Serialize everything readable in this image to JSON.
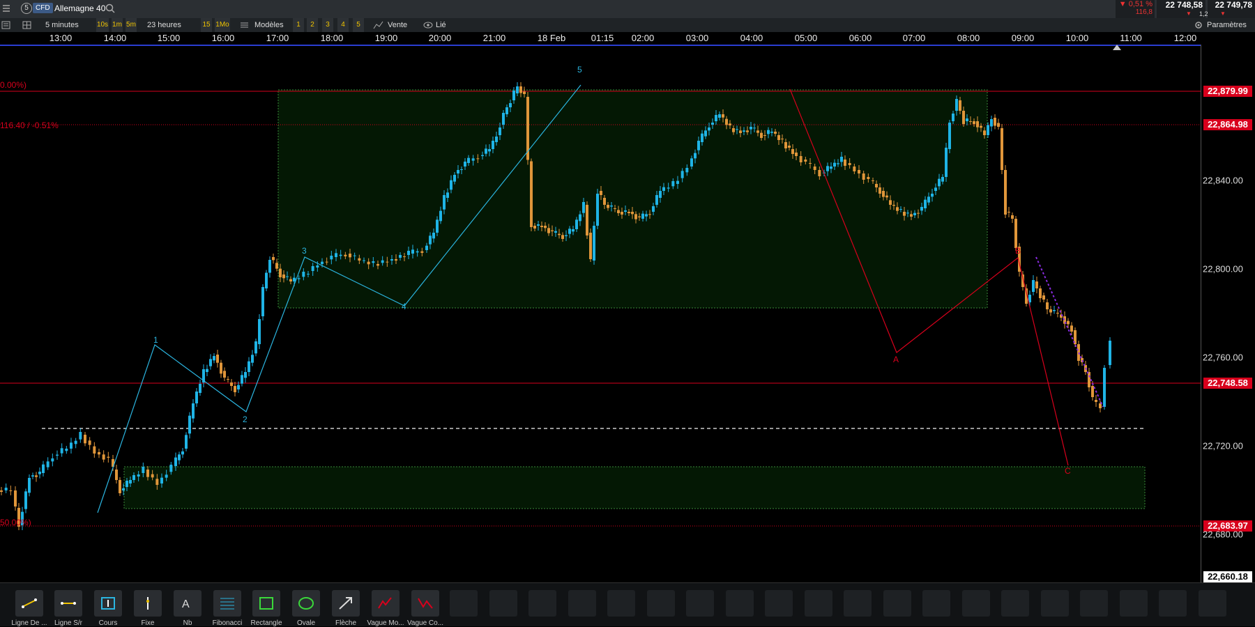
{
  "top": {
    "badge_num": "5",
    "badge_type": "CFD",
    "instrument": "Allemagne 40",
    "change_pct": "▼ 0,51 %",
    "change_pts": "116,8",
    "bid": "22 748,58",
    "spread": "1,20",
    "ask": "22 749,78"
  },
  "toolbar": {
    "timeframe": "5 minutes",
    "tf_10s": "10s",
    "tf_1m": "1m",
    "tf_5m": "5m",
    "duration": "23 heures",
    "d_15": "15",
    "d_1mo": "1Mo",
    "models": "Modèles",
    "m1": "1",
    "m2": "2",
    "m3": "3",
    "m4": "4",
    "m5": "5",
    "sell": "Vente",
    "linked": "Lié",
    "settings": "Paramètres"
  },
  "time_ticks": [
    "13:00",
    "14:00",
    "15:00",
    "16:00",
    "17:00",
    "18:00",
    "19:00",
    "20:00",
    "21:00",
    "18 Feb",
    "01:15",
    "02:00",
    "03:00",
    "04:00",
    "05:00",
    "06:00",
    "07:00",
    "08:00",
    "09:00",
    "10:00",
    "11:00",
    "12:00"
  ],
  "price_ticks": [
    "22,840.00",
    "22,800.00",
    "22,760.00",
    "22,720.00",
    "22,680.00"
  ],
  "price_tags": {
    "high": "22,879.99",
    "mid": "22,864.98",
    "last": "22,748.58",
    "low": "22,683.97",
    "bottom": "22,660.18"
  },
  "fib_labels": {
    "top": "0.00%)",
    "second": "116.40 / -0.51%",
    "bottom": "50.00%)"
  },
  "wave_labels": {
    "w1": "1",
    "w2": "2",
    "w3": "3",
    "w4": "4",
    "w5": "5",
    "wa": "A",
    "wb": "B",
    "wc": "C"
  },
  "tools": [
    {
      "label": "Ligne De ...",
      "icon": "trendline-icon"
    },
    {
      "label": "Ligne S/r",
      "icon": "sr-line-icon"
    },
    {
      "label": "Cours",
      "icon": "price-icon"
    },
    {
      "label": "Fixe",
      "icon": "fixed-icon"
    },
    {
      "label": "Nb",
      "icon": "text-icon"
    },
    {
      "label": "Fibonacci",
      "icon": "fibonacci-icon"
    },
    {
      "label": "Rectangle",
      "icon": "rectangle-icon"
    },
    {
      "label": "Ovale",
      "icon": "oval-icon"
    },
    {
      "label": "Flèche",
      "icon": "arrow-icon"
    },
    {
      "label": "Vague Mo...",
      "icon": "wave-motive-icon"
    },
    {
      "label": "Vague Co...",
      "icon": "wave-corrective-icon"
    }
  ],
  "colors": {
    "up": "#1fb4e6",
    "down": "#e0963a",
    "fib": "#d8001c",
    "wave_motive": "#2bb5e0",
    "wave_corrective": "#d8001c",
    "zone": "#0a2a0a"
  }
}
